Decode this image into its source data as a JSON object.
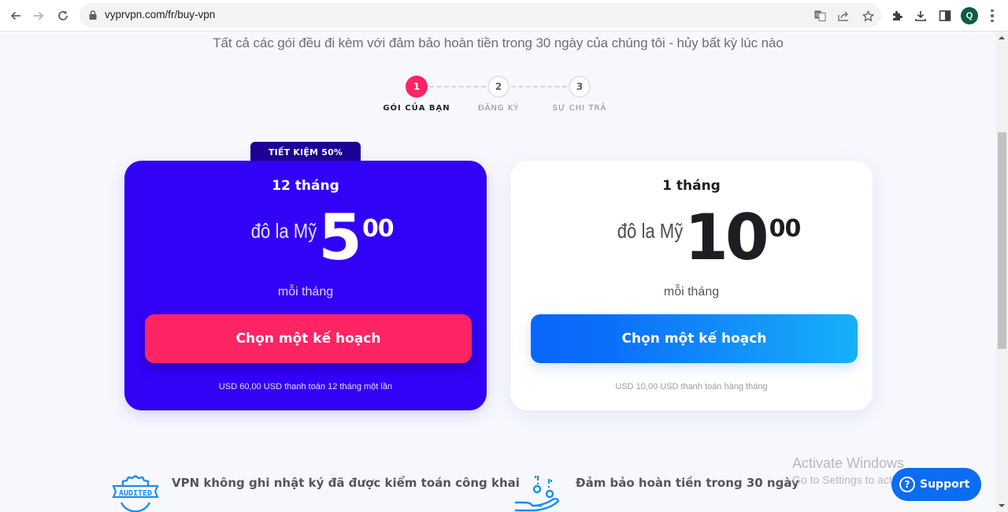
{
  "browser": {
    "url": "vyprvpn.com/fr/buy-vpn",
    "profile_initial": "Q",
    "icons": [
      "back-arrow-icon",
      "forward-arrow-icon",
      "reload-icon",
      "lock-icon",
      "translate-icon",
      "share-icon",
      "bookmark-star-icon",
      "extensions-puzzle-icon",
      "download-icon",
      "side-panel-icon",
      "kebab-menu-icon"
    ]
  },
  "page": {
    "subtitle": "Tất cả các gói đều đi kèm với đảm bảo hoàn tiền trong 30 ngày của chúng tôi - hủy bất kỳ lúc nào",
    "steps": [
      {
        "number": "1",
        "label": "GÓI CỦA BẠN",
        "active": true
      },
      {
        "number": "2",
        "label": "ĐĂNG KÝ",
        "active": false
      },
      {
        "number": "3",
        "label": "SỰ CHI TRẢ",
        "active": false
      }
    ],
    "plans": [
      {
        "badge": "TIẾT KIỆM 50%",
        "term": "12 tháng",
        "currency": "đô la Mỹ",
        "amount": "5",
        "cents": "00",
        "per": "mỗi tháng",
        "cta": "Chọn một kế hoạch",
        "billing": "USD 60,00 USD thanh toán 12 tháng một lần"
      },
      {
        "term": "1 tháng",
        "currency": "đô la Mỹ",
        "amount": "10",
        "cents": "00",
        "per": "mỗi tháng",
        "cta": "Chọn một kế hoạch",
        "billing": "USD 10,00 USD thanh toán hàng tháng"
      }
    ],
    "features": [
      {
        "icon": "audited-badge-icon",
        "icon_text": "AUDITED",
        "title": "VPN không ghi nhật ký đã được kiểm toán công khai"
      },
      {
        "icon": "money-back-hand-icon",
        "title": "Đảm bảo hoàn tiền trong 30 ngày"
      }
    ]
  },
  "overlay": {
    "watermark_title": "Activate Windows",
    "watermark_sub": "Go to Settings to activate Windows.",
    "support_label": "Support"
  },
  "colors": {
    "featured_card": "#3202f7",
    "badge": "#1c0096",
    "accent_pink": "#ff2464",
    "accent_blue": "#0867fb",
    "page_bg": "#f7f8fd"
  }
}
